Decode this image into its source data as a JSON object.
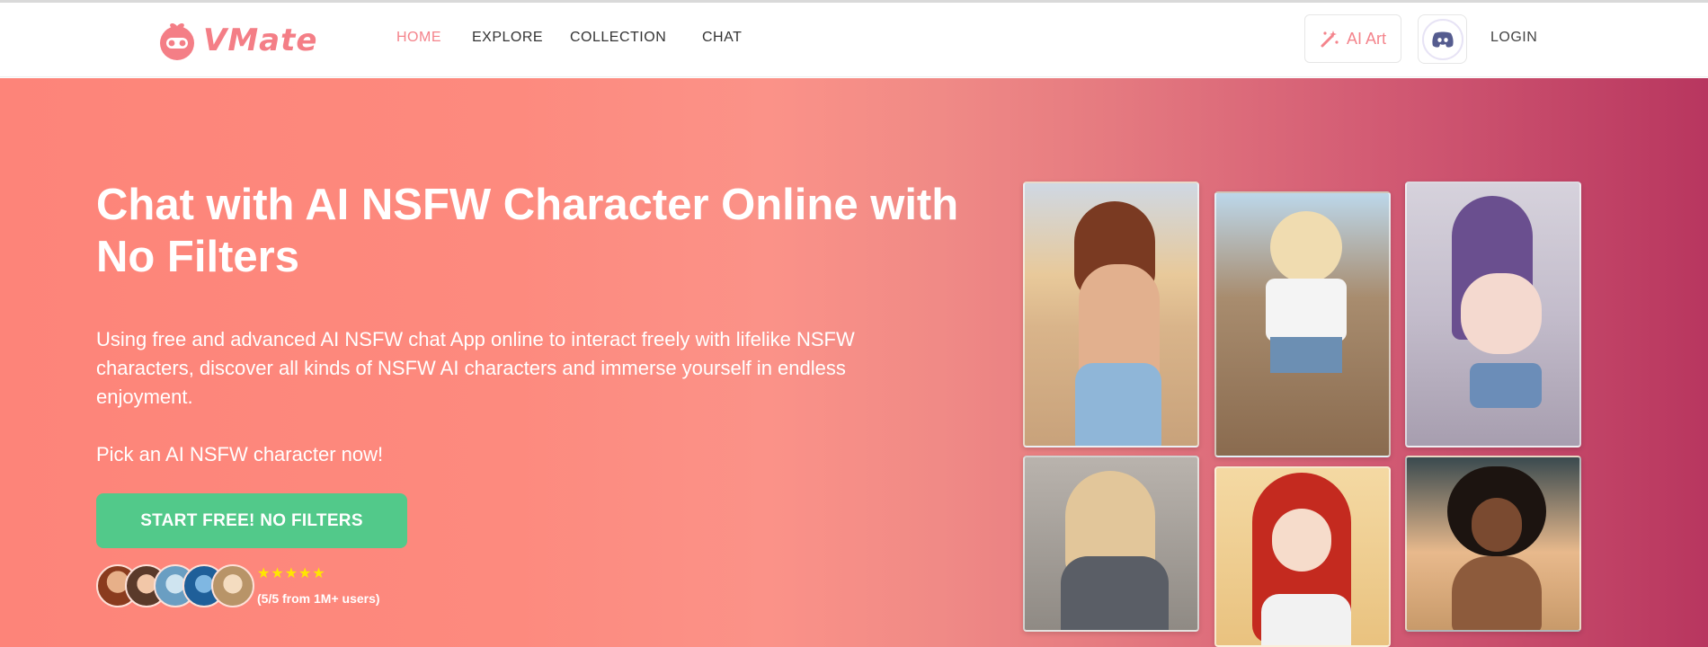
{
  "brand": {
    "name": "VMate",
    "accent": "#f4848c"
  },
  "nav": {
    "items": [
      {
        "label": "HOME",
        "active": true
      },
      {
        "label": "EXPLORE",
        "active": false
      },
      {
        "label": "COLLECTION",
        "active": false
      },
      {
        "label": "CHAT",
        "active": false
      }
    ],
    "ai_art_label": "AI Art",
    "discord_icon": "discord-icon",
    "login_label": "LOGIN"
  },
  "hero": {
    "title": "Chat with AI NSFW Character Online with No Filters",
    "description": "Using free and advanced AI NSFW chat App online to interact freely with lifelike NSFW characters, discover all kinds of NSFW AI characters and immerse yourself in endless enjoyment.",
    "pick": "Pick an AI NSFW character now!",
    "cta_label": "START FREE! NO FILTERS",
    "cta_color": "#52c98a",
    "stars": "★★★★★",
    "rating_text": "(5/5 from 1M+ users)",
    "rating_value": 5,
    "gradient": [
      "#fd8479",
      "#fb9288",
      "#d35c74",
      "#b8365f"
    ]
  },
  "gallery": [
    {
      "name": "character-card-1"
    },
    {
      "name": "character-card-2"
    },
    {
      "name": "character-card-3"
    },
    {
      "name": "character-card-4"
    },
    {
      "name": "character-card-5"
    },
    {
      "name": "character-card-6"
    }
  ]
}
